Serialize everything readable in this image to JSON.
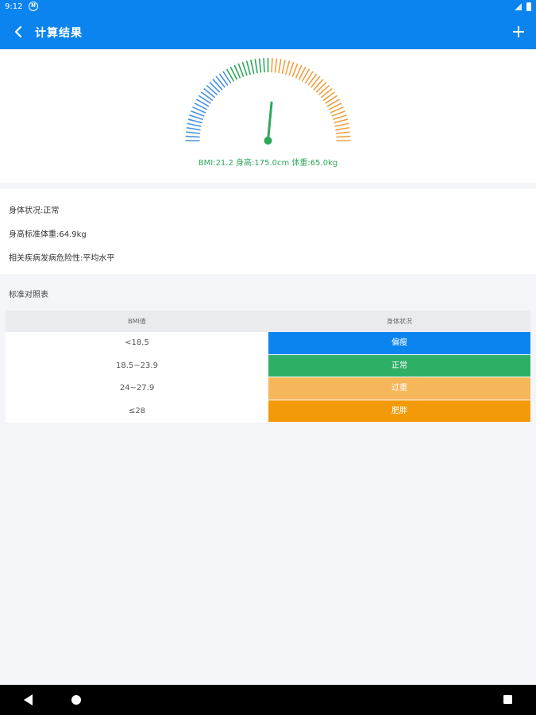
{
  "status_bar": {
    "time": "9:12",
    "sys_icon": "N"
  },
  "app_bar": {
    "title": "计算结果",
    "back_icon": "chevron-left-icon",
    "add_icon": "plus-icon"
  },
  "gauge": {
    "bmi": 21.2,
    "min": 0,
    "max": 40,
    "label": "BMI:21.2  身高:175.0cm  体重:65.0kg",
    "colors": {
      "blue": "#4a90e2",
      "green": "#2ea85b",
      "orange": "#f0a040"
    }
  },
  "info": {
    "status": "身体状况:正常",
    "standard_weight": "身高标准体重:64.9kg",
    "risk": "相关疾病发病危险性:平均水平"
  },
  "section_title": "标准对照表",
  "table": {
    "headers": [
      "BMI值",
      "身体状况"
    ],
    "rows": [
      {
        "range": "<18.5",
        "status": "偏瘦",
        "color": "#0b84f0"
      },
      {
        "range": "18.5~23.9",
        "status": "正常",
        "color": "#2eaf66"
      },
      {
        "range": "24~27.9",
        "status": "过重",
        "color": "#f6b65a"
      },
      {
        "range": "≤28",
        "status": "肥胖",
        "color": "#f39a0a"
      }
    ]
  }
}
